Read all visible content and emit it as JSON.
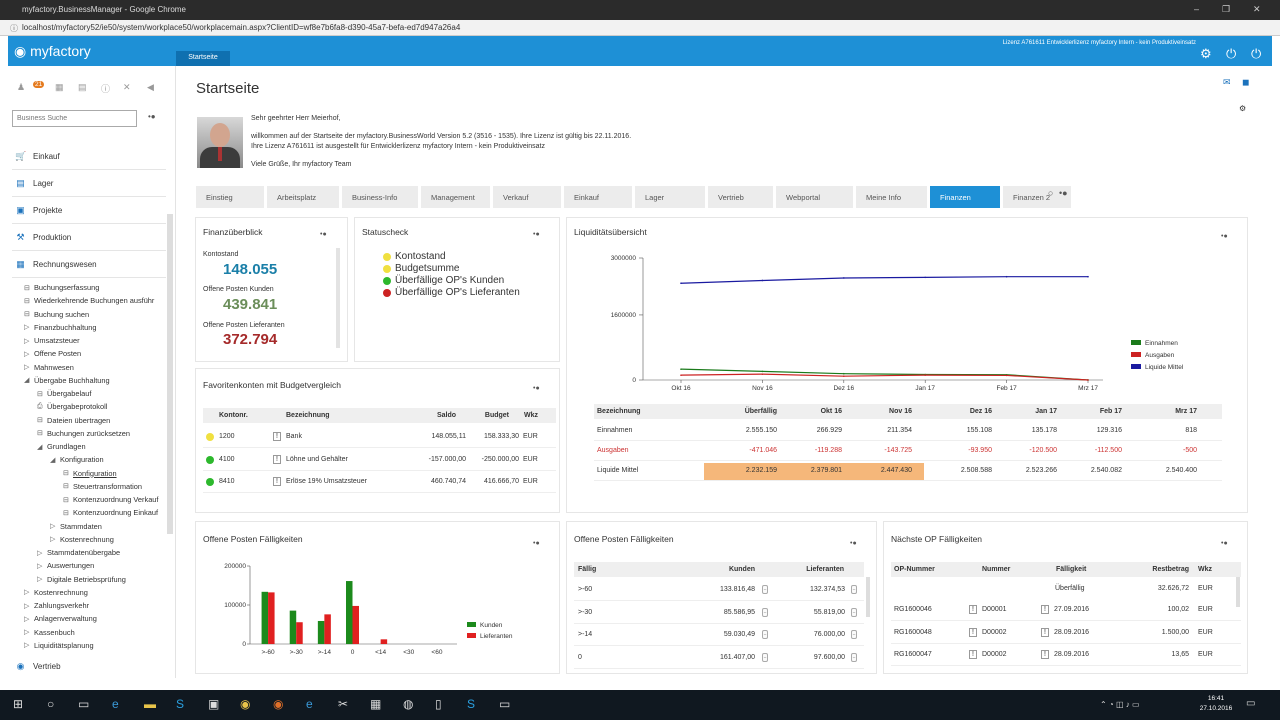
{
  "browser": {
    "window_title": "myfactory.BusinessManager - Google Chrome",
    "url": "localhost/myfactory52/ie50/system/workplace50/workplacemain.aspx?ClientID=wf8e7b6fa8-d390-45a7-befa-ed7d947a26a4"
  },
  "header": {
    "logo": "myfactory",
    "start_tab": "Startseite",
    "license": "Lizenz A761611 Entwicklerlizenz myfactory Intern - kein Produktiveinsatz"
  },
  "sidebar": {
    "toolbar_badge": "21",
    "search_placeholder": "Business Suche",
    "main": [
      {
        "label": "Einkauf",
        "icon": "cart-icon"
      },
      {
        "label": "Lager",
        "icon": "warehouse-icon"
      },
      {
        "label": "Projekte",
        "icon": "project-icon"
      },
      {
        "label": "Produktion",
        "icon": "production-icon"
      },
      {
        "label": "Rechnungswesen",
        "icon": "grid-icon"
      }
    ],
    "tree": [
      {
        "label": "Buchungserfassung",
        "level": 1,
        "icon": "doc-icon"
      },
      {
        "label": "Wiederkehrende Buchungen ausführ",
        "level": 1,
        "icon": "doc-icon"
      },
      {
        "label": "Buchung suchen",
        "level": 1,
        "icon": "doc-icon"
      },
      {
        "label": "Finanzbuchhaltung",
        "level": 1,
        "icon": "expand-icon"
      },
      {
        "label": "Umsatzsteuer",
        "level": 1,
        "icon": "expand-icon"
      },
      {
        "label": "Offene Posten",
        "level": 1,
        "icon": "expand-icon"
      },
      {
        "label": "Mahnwesen",
        "level": 1,
        "icon": "expand-icon"
      },
      {
        "label": "Übergabe Buchhaltung",
        "level": 1,
        "icon": "collapse-icon"
      },
      {
        "label": "Übergabelauf",
        "level": 2,
        "icon": "doc-icon"
      },
      {
        "label": "Übergabeprotokoll",
        "level": 2,
        "icon": "print-icon"
      },
      {
        "label": "Dateien übertragen",
        "level": 2,
        "icon": "doc-icon"
      },
      {
        "label": "Buchungen zurücksetzen",
        "level": 2,
        "icon": "doc-icon"
      },
      {
        "label": "Grundlagen",
        "level": 2,
        "icon": "collapse-icon"
      },
      {
        "label": "Konfiguration",
        "level": 3,
        "icon": "collapse-icon"
      },
      {
        "label": "Konfiguration",
        "level": 4,
        "icon": "doc-icon",
        "selected": true
      },
      {
        "label": "Steuertransformation",
        "level": 4,
        "icon": "doc-icon"
      },
      {
        "label": "Kontenzuordnung Verkauf",
        "level": 4,
        "icon": "doc-icon"
      },
      {
        "label": "Kontenzuordnung Einkauf",
        "level": 4,
        "icon": "doc-icon"
      },
      {
        "label": "Stammdaten",
        "level": 3,
        "icon": "expand-icon"
      },
      {
        "label": "Kostenrechnung",
        "level": 3,
        "icon": "expand-icon"
      },
      {
        "label": "Stammdatenübergabe",
        "level": 2,
        "icon": "expand-icon"
      },
      {
        "label": "Auswertungen",
        "level": 2,
        "icon": "expand-icon"
      },
      {
        "label": "Digitale Betriebsprüfung",
        "level": 2,
        "icon": "expand-icon"
      },
      {
        "label": "Kostenrechnung",
        "level": 1,
        "icon": "expand-icon"
      },
      {
        "label": "Zahlungsverkehr",
        "level": 1,
        "icon": "expand-icon"
      },
      {
        "label": "Anlagenverwaltung",
        "level": 1,
        "icon": "expand-icon"
      },
      {
        "label": "Kassenbuch",
        "level": 1,
        "icon": "expand-icon"
      },
      {
        "label": "Liquiditätsplanung",
        "level": 1,
        "icon": "expand-icon"
      }
    ],
    "vertrieb": "Vertrieb"
  },
  "page": {
    "title": "Startseite",
    "welcome": [
      "Sehr geehrter Herr Meierhof,",
      "willkommen auf der Startseite der myfactory.BusinessWorld Version 5.2 (3516 - 1535). Ihre Lizenz ist gültig bis 22.11.2016.",
      "Ihre Lizenz A761611 ist ausgestellt für Entwicklerlizenz myfactory Intern - kein Produktiveinsatz",
      "Viele Grüße, Ihr myfactory Team"
    ],
    "tabs": [
      "Einstieg",
      "Arbeitsplatz",
      "Business-Info",
      "Management",
      "Verkauf",
      "Einkauf",
      "Lager",
      "Vertrieb",
      "Webportal",
      "Meine Info",
      "Finanzen",
      "Finanzen 2"
    ],
    "active_tab": "Finanzen"
  },
  "finanz": {
    "title": "Finanzüberblick",
    "items": [
      {
        "label": "Kontostand",
        "value": "148.055",
        "color": "#1a7fa8"
      },
      {
        "label": "Offene Posten Kunden",
        "value": "439.841",
        "color": "#6b8e5a"
      },
      {
        "label": "Offene Posten Lieferanten",
        "value": "372.794",
        "color": "#a52a2a"
      }
    ]
  },
  "status": {
    "title": "Statuscheck",
    "items": [
      {
        "label": "Kontostand",
        "color": "#f0e040"
      },
      {
        "label": "Budgetsumme",
        "color": "#f0e040"
      },
      {
        "label": "Überfällige OP's Kunden",
        "color": "#2db82d"
      },
      {
        "label": "Überfällige OP's Lieferanten",
        "color": "#cc2222"
      }
    ]
  },
  "budget": {
    "title": "Favoritenkonten mit Budgetvergleich",
    "headers": [
      "Kontonr.",
      "Bezeichnung",
      "Saldo",
      "Budget",
      "Wkz"
    ],
    "rows": [
      {
        "dot": "#f0e040",
        "konto": "1200",
        "bez": "Bank",
        "saldo": "148.055,11",
        "budget": "158.333,30",
        "wkz": "EUR"
      },
      {
        "dot": "#2db82d",
        "konto": "4100",
        "bez": "Löhne und Gehälter",
        "saldo": "-157.000,00",
        "budget": "-250.000,00",
        "wkz": "EUR"
      },
      {
        "dot": "#2db82d",
        "konto": "8410",
        "bez": "Erlöse 19% Umsatzsteuer",
        "saldo": "460.740,74",
        "budget": "416.666,70",
        "wkz": "EUR"
      }
    ]
  },
  "liq": {
    "title": "Liquiditätsübersicht",
    "headers": [
      "Bezeichnung",
      "Überfällig",
      "Okt 16",
      "Nov 16",
      "Dez 16",
      "Jan 17",
      "Feb 17",
      "Mrz 17"
    ],
    "rows": [
      {
        "label": "Einnahmen",
        "color": "#333",
        "cells": [
          "2.555.150",
          "266.929",
          "211.354",
          "155.108",
          "135.178",
          "129.316",
          "818"
        ]
      },
      {
        "label": "Ausgaben",
        "color": "#cc3333",
        "cells": [
          "-471.046",
          "-119.288",
          "-143.725",
          "-93.950",
          "-120.500",
          "-112.500",
          "-500"
        ]
      },
      {
        "label": "Liquide Mittel",
        "color": "#333",
        "cells": [
          "2.232.159",
          "2.379.801",
          "2.447.430",
          "2.508.588",
          "2.523.266",
          "2.540.082",
          "2.540.400"
        ]
      }
    ]
  },
  "chart_data": [
    {
      "type": "line",
      "title": "",
      "x": [
        "Okt 16",
        "Nov 16",
        "Dez 16",
        "Jan 17",
        "Feb 17",
        "Mrz 17"
      ],
      "y_ticks": [
        "3000000",
        "1600000",
        "0"
      ],
      "ylim": [
        0,
        3000000
      ],
      "legend": "right",
      "series": [
        {
          "name": "Einnahmen",
          "color": "#1a7a1a",
          "values": [
            266929,
            211354,
            155108,
            135178,
            129316,
            818
          ]
        },
        {
          "name": "Ausgaben",
          "color": "#cc2222",
          "values": [
            119288,
            143725,
            93950,
            120500,
            112500,
            500
          ]
        },
        {
          "name": "Liquide Mittel",
          "color": "#1a1aa0",
          "values": [
            2379801,
            2447430,
            2508588,
            2523266,
            2540082,
            2540400
          ]
        }
      ]
    },
    {
      "type": "bar",
      "title": "",
      "categories": [
        ">-60",
        ">-30",
        ">-14",
        "0",
        "<14",
        "<30",
        "<60"
      ],
      "y_ticks": [
        "200000",
        "100000",
        "0"
      ],
      "ylim": [
        0,
        200000
      ],
      "legend": "right",
      "series": [
        {
          "name": "Kunden",
          "color": "#1c8a1c",
          "values": [
            133816,
            85587,
            59030,
            161407,
            0,
            0,
            0
          ]
        },
        {
          "name": "Lieferanten",
          "color": "#e02020",
          "values": [
            132374,
            55819,
            76000,
            97600,
            12000,
            0,
            0
          ]
        }
      ]
    }
  ],
  "op1": {
    "title": "Offene Posten Fälligkeiten"
  },
  "op2": {
    "title": "Offene Posten Fälligkeiten",
    "headers": [
      "Fällig",
      "Kunden",
      "Lieferanten"
    ],
    "rows": [
      {
        "f": ">-60",
        "k": "133.816,48",
        "l": "132.374,53"
      },
      {
        "f": ">-30",
        "k": "85.586,95",
        "l": "55.819,00"
      },
      {
        "f": ">-14",
        "k": "59.030,49",
        "l": "76.000,00"
      },
      {
        "f": "0",
        "k": "161.407,00",
        "l": "97.600,00"
      }
    ]
  },
  "nop": {
    "title": "Nächste OP Fälligkeiten",
    "headers": [
      "OP-Nummer",
      "Nummer",
      "Fälligkeit",
      "Restbetrag",
      "Wkz"
    ],
    "overdue": {
      "label": "Überfällig",
      "amount": "32.626,72",
      "wkz": "EUR"
    },
    "rows": [
      {
        "op": "RG1600046",
        "nr": "D00001",
        "date": "27.09.2016",
        "amt": "100,02",
        "wkz": "EUR"
      },
      {
        "op": "RG1600048",
        "nr": "D00002",
        "date": "28.09.2016",
        "amt": "1.500,00",
        "wkz": "EUR"
      },
      {
        "op": "RG1600047",
        "nr": "D00002",
        "date": "28.09.2016",
        "amt": "13,65",
        "wkz": "EUR"
      }
    ]
  },
  "taskbar": {
    "time": "16:41",
    "date": "27.10.2016"
  }
}
